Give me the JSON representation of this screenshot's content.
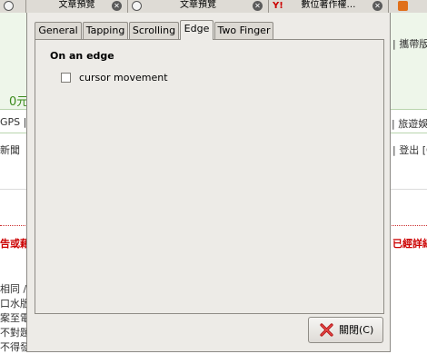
{
  "browser": {
    "tabs": [
      {
        "title": "文章預覽",
        "icon": "page-icon"
      },
      {
        "title": "文章預覽",
        "icon": "page-icon"
      },
      {
        "title": "數位著作權…",
        "icon": "yahoo-icon"
      },
      {
        "title": "",
        "icon": "rss-icon"
      }
    ],
    "yahoo_glyph": "Y!",
    "background_text": {
      "brand_right": "| 攜帶版",
      "price": "0元",
      "nav_left": "GPS |",
      "nav_right": "| 旅遊娛",
      "news_left": "新聞",
      "news_right": "| 登出 [G",
      "red_left": "告或藉",
      "red_right": "已經詳細",
      "body_lines": [
        "相同 /",
        "口水版",
        "案至電",
        "不對題",
        "不得發"
      ]
    }
  },
  "dialog": {
    "tabs": [
      "General",
      "Tapping",
      "Scrolling",
      "Edge",
      "Two Finger"
    ],
    "active_tab": "Edge",
    "section_heading": "On an edge",
    "checkbox": {
      "label": "cursor movement",
      "checked": false
    },
    "close_button_label": "關閉(C)"
  },
  "colors": {
    "dialog_bg": "#edebe7",
    "background_green": "#eef6ea",
    "alert_red": "#cc0000",
    "price_green": "#3a8a1a"
  }
}
